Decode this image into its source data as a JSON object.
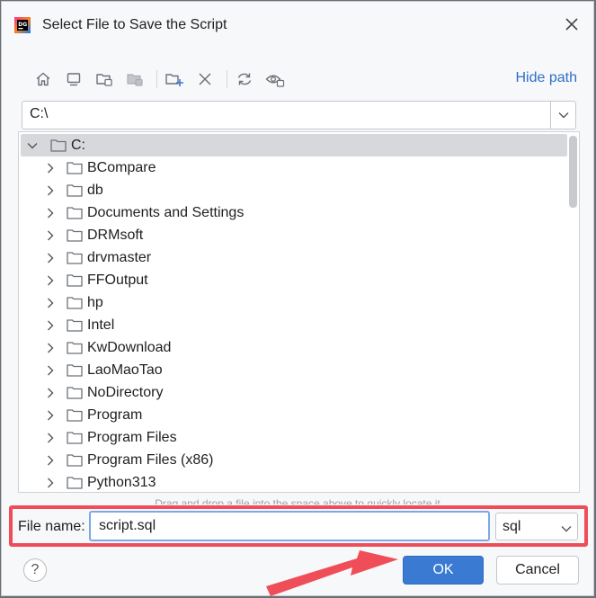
{
  "window": {
    "title": "Select File to Save the Script",
    "app_icon": "jetbrains-icon",
    "close_icon": "close-icon"
  },
  "toolbar": {
    "buttons": [
      {
        "name": "home-icon",
        "tooltip": ""
      },
      {
        "name": "desktop-icon",
        "tooltip": ""
      },
      {
        "name": "project-folder-icon",
        "tooltip": ""
      },
      {
        "name": "module-folder-icon",
        "tooltip": ""
      },
      {
        "name": "new-folder-icon",
        "tooltip": ""
      },
      {
        "name": "delete-icon",
        "tooltip": ""
      },
      {
        "name": "refresh-icon",
        "tooltip": ""
      },
      {
        "name": "show-hidden-icon",
        "tooltip": ""
      }
    ],
    "hide_path_label": "Hide path"
  },
  "path": {
    "value": "C:\\"
  },
  "tree": {
    "root": {
      "label": "C:",
      "expanded": true,
      "selected": true
    },
    "items": [
      {
        "label": "BCompare"
      },
      {
        "label": "db"
      },
      {
        "label": "Documents and Settings"
      },
      {
        "label": "DRMsoft"
      },
      {
        "label": "drvmaster"
      },
      {
        "label": "FFOutput"
      },
      {
        "label": "hp"
      },
      {
        "label": "Intel"
      },
      {
        "label": "KwDownload"
      },
      {
        "label": "LaoMaoTao"
      },
      {
        "label": "NoDirectory"
      },
      {
        "label": "Program"
      },
      {
        "label": "Program Files"
      },
      {
        "label": "Program Files (x86)"
      },
      {
        "label": "Python313"
      }
    ],
    "drag_hint": "Drag and drop a file into the space above to quickly locate it"
  },
  "file_name": {
    "label": "File name:",
    "value": "script.sql"
  },
  "extension": {
    "selected": "sql"
  },
  "buttons": {
    "help": "?",
    "ok": "OK",
    "cancel": "Cancel"
  },
  "colors": {
    "accent": "#3a7ad2",
    "highlight_border": "#ef4e59",
    "link": "#2f6fc7",
    "selection": "#d6d8dc"
  }
}
